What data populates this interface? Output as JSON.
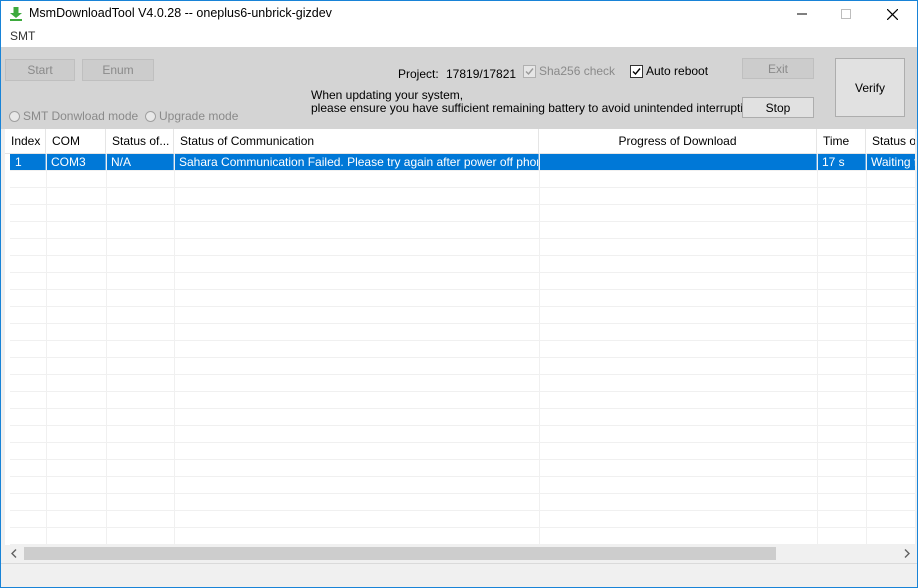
{
  "window": {
    "title": "MsmDownloadTool V4.0.28 -- oneplus6-unbrick-gizdev",
    "icon": "download-arrow-icon",
    "accent": "#1883d7"
  },
  "menu": {
    "items": [
      "SMT"
    ]
  },
  "toolbar": {
    "start_label": "Start",
    "enum_label": "Enum",
    "smt_mode_label": "SMT Donwload mode",
    "upgrade_mode_label": "Upgrade mode",
    "project_label": "Project:",
    "project_value": "17819/17821",
    "sha256_label": "Sha256 check",
    "sha256_checked": true,
    "auto_reboot_label": "Auto reboot",
    "auto_reboot_checked": true,
    "notice_line1": "When updating your system,",
    "notice_line2": "please ensure you have sufficient remaining battery to avoid unintended interruptions.",
    "exit_label": "Exit",
    "stop_label": "Stop",
    "verify_label": "Verify"
  },
  "table": {
    "columns": [
      "Index",
      "COM",
      "Status of...",
      "Status of Communication",
      "Progress of Download",
      "Time",
      "Status of"
    ],
    "rows": [
      {
        "index": "1",
        "com": "COM3",
        "status": "N/A",
        "communication": "Sahara Communication Failed. Please try again after power off phone",
        "progress": "",
        "time": "17 s",
        "status2": "Waiting f"
      }
    ],
    "selection_color": "#0078d7"
  },
  "scrollbar": {
    "left_icon": "chevron-left-icon",
    "right_icon": "chevron-right-icon"
  }
}
